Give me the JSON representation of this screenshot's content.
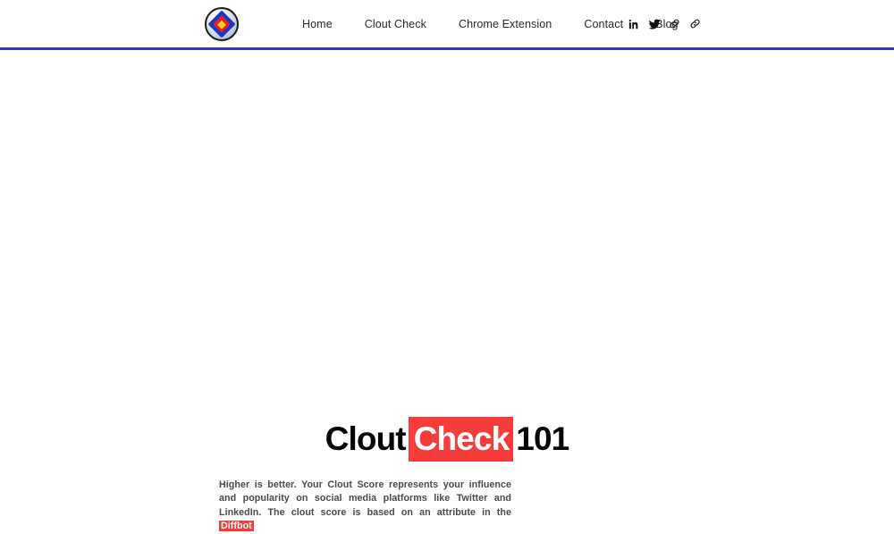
{
  "header": {
    "logo": {
      "icon": "diamond-badge-logo",
      "colors": {
        "outer": "#1b36c8",
        "middle": "#e02020",
        "inner": "#f4d21a"
      }
    },
    "nav_items": [
      {
        "label": "Home",
        "name": "nav-item-home"
      },
      {
        "label": "Clout Check",
        "name": "nav-item-clout-check"
      },
      {
        "label": "Chrome Extension",
        "name": "nav-item-chrome-extension"
      },
      {
        "label": "Contact",
        "name": "nav-item-contact"
      },
      {
        "label": "Blog",
        "name": "nav-item-blog"
      }
    ],
    "social_icons": [
      {
        "icon": "linkedin-icon",
        "label": "LinkedIn"
      },
      {
        "icon": "twitter-icon",
        "label": "Twitter"
      },
      {
        "icon": "link-icon",
        "label": "Link"
      },
      {
        "icon": "link-icon",
        "label": "Link"
      }
    ],
    "rule_color": "#3535c8"
  },
  "hero": {
    "title": {
      "part_plain": "Clout",
      "part_highlight": "Check",
      "part_suffix": "101"
    },
    "paragraph": {
      "text_before": "Higher is better. Your Clout Score represents your influence and popularity on social media platforms like Twitter and LinkedIn. The clout score is based on an attribute in the ",
      "highlight": "Diffbot"
    }
  },
  "colors": {
    "accent_red": "#f73c3c",
    "accent_blue": "#3535c8",
    "text_dark": "#050505",
    "text_body": "#4a4a4a",
    "background": "#ffffff"
  }
}
